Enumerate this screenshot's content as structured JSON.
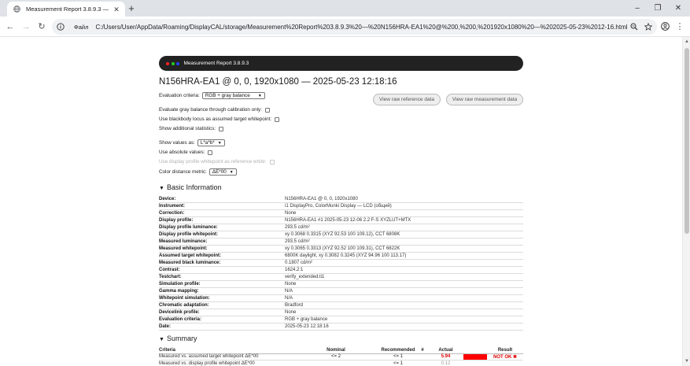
{
  "browser": {
    "tab_title": "Measurement Report 3.8.9.3 —",
    "address_label": "Файл",
    "url": "C:/Users/User/AppData/Roaming/DisplayCAL/storage/Measurement%20Report%203.8.9.3%20—%20N156HRA-EA1%20@%200,%200,%201920x1080%20—%202025-05-23%2012-16.html"
  },
  "header": {
    "bar_text": "Measurement Report 3.8.9.3",
    "dot_colors": [
      "#ff2222",
      "#22cc22",
      "#2244ff"
    ],
    "title": "N156HRA-EA1 @ 0, 0, 1920x1080 — 2025-05-23 12:18:16"
  },
  "controls": {
    "evaluation_criteria_label": "Evaluation criteria:",
    "evaluation_criteria_value": "RGB + gray balance",
    "gray_balance_label": "Evaluate gray balance through calibration only:",
    "blackbody_label": "Use blackbody locus as assumed target whitepoint:",
    "additional_stats_label": "Show additional statistics:",
    "show_values_label": "Show values as:",
    "show_values_value": "L*a*b*",
    "absolute_values_label": "Use absolute values:",
    "display_profile_white_label": "Use display profile whitepoint as reference white:",
    "color_distance_label": "Color distance metric:",
    "color_distance_value": "ΔE*00",
    "view_reference_button": "View raw reference data",
    "view_measurement_button": "View raw measurement data"
  },
  "basic_info": {
    "heading": "Basic Information",
    "rows": [
      {
        "k": "Device:",
        "v": "N156HRA-EA1 @ 0, 0, 1920x1080"
      },
      {
        "k": "Instrument:",
        "v": "i1 DisplayPro, ColorMunki Display — LCD (общий)"
      },
      {
        "k": "Correction:",
        "v": "None"
      },
      {
        "k": "Display profile:",
        "v": "N156HRA-EA1 #1 2025-05-23 12-06 2.2 F-S XYZLUT+MTX"
      },
      {
        "k": "Display profile luminance:",
        "v": "293.5 cd/m²"
      },
      {
        "k": "Display profile whitepoint:",
        "v": "xy 0.3068 0.3315 (XYZ 92.53 100 109.12), CCT 6808K"
      },
      {
        "k": "Measured luminance:",
        "v": "293.5 cd/m²"
      },
      {
        "k": "Measured whitepoint:",
        "v": "xy 0.3065 0.3313 (XYZ 92.52 100 109.31), CCT 6822K"
      },
      {
        "k": "Assumed target whitepoint:",
        "v": "6800K daylight, xy 0.3082 0.3245 (XYZ 94.96 100 113.17)"
      },
      {
        "k": "Measured black luminance:",
        "v": "0.1807 cd/m²"
      },
      {
        "k": "Contrast:",
        "v": "1624.2:1"
      },
      {
        "k": "Testchart:",
        "v": "verify_extended.ti1"
      },
      {
        "k": "Simulation profile:",
        "v": "None"
      },
      {
        "k": "Gamma mapping:",
        "v": "N/A"
      },
      {
        "k": "Whitepoint simulation:",
        "v": "N/A"
      },
      {
        "k": "Chromatic adaptation:",
        "v": "Bradford"
      },
      {
        "k": "Devicelink profile:",
        "v": "None"
      },
      {
        "k": "Evaluation criteria:",
        "v": "RGB + gray balance"
      },
      {
        "k": "Date:",
        "v": "2025-05-23 12:18:16"
      }
    ]
  },
  "summary": {
    "heading": "Summary",
    "columns": [
      "Criteria",
      "Nominal",
      "Recommended",
      "#",
      "Actual",
      "",
      "Result"
    ],
    "rows": [
      {
        "criteria": "Measured vs. assumed target whitepoint ΔE*00",
        "nominal": "<= 2",
        "recommended": "<= 1",
        "num": "",
        "actual": "5.94",
        "result": "NOT OK ✖",
        "fraction": 1.0
      },
      {
        "criteria": "Measured vs. display profile whitepoint ΔE*00",
        "nominal": "",
        "recommended": "<= 1",
        "num": "",
        "actual": "0.12",
        "result": "",
        "fraction": 0.0
      }
    ]
  }
}
